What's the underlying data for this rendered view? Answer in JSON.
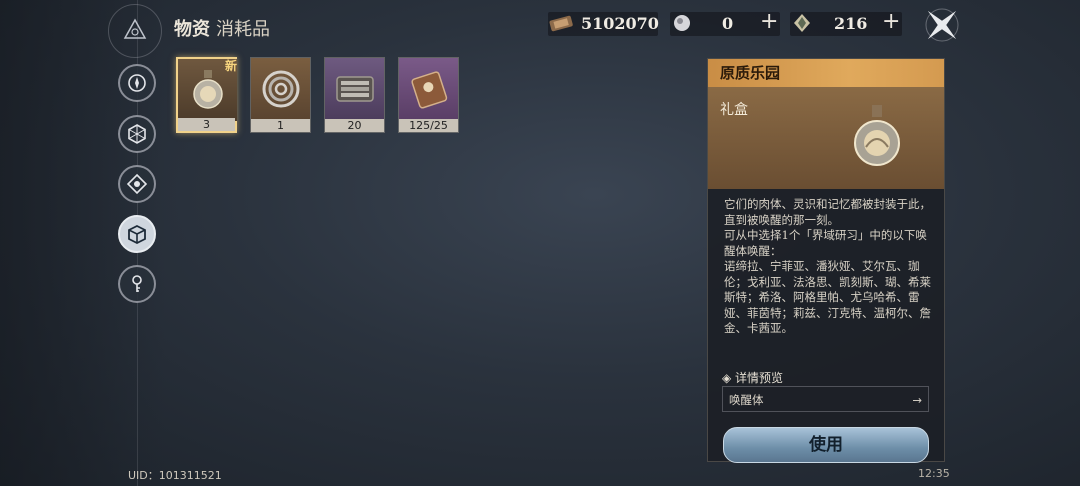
{
  "header": {
    "title": "物资",
    "subtitle": "消耗品"
  },
  "currencies": [
    {
      "icon": "ticket-currency-icon",
      "value": "5102070"
    },
    {
      "icon": "orb-currency-icon",
      "value": "0",
      "plus": "+"
    },
    {
      "icon": "crystal-currency-icon",
      "value": "216",
      "plus": "+"
    }
  ],
  "nav": [
    {
      "name": "nav-compass",
      "icon": "compass-icon"
    },
    {
      "name": "nav-hexagon",
      "icon": "hexagon-icon"
    },
    {
      "name": "nav-target",
      "icon": "target-icon"
    },
    {
      "name": "nav-box",
      "icon": "box-icon",
      "active": true
    },
    {
      "name": "nav-key",
      "icon": "key-icon"
    }
  ],
  "items": [
    {
      "icon": "flask-icon",
      "qty": "3",
      "badge": "新",
      "selected": true
    },
    {
      "icon": "spiral-icon",
      "qty": "1"
    },
    {
      "icon": "tool-case-icon",
      "qty": "20"
    },
    {
      "icon": "ticket-case-icon",
      "qty": "125/25"
    }
  ],
  "detail": {
    "name": "原质乐园",
    "type": "礼盒",
    "description": "它们的肉体、灵识和记忆都被封装于此，直到被唤醒的那一刻。\n可从中选择1个「界域研习」中的以下唤醒体唤醒：\n诺缔拉、宁菲亚、潘狄娅、艾尔瓦、珈伦；戈利亚、法洛思、凯刻斯、瑚、希莱斯特；希洛、阿格里帕、尤乌哈希、雷娅、菲茵特；莉兹、汀克特、温柯尔、詹金、卡茜亚。",
    "preview_label": "◈ 详情预览",
    "preview_value": "唤醒体",
    "preview_arrow": "→",
    "use_label": "使用"
  },
  "footer": {
    "uid": "UID：101311521",
    "time": "12:35"
  }
}
